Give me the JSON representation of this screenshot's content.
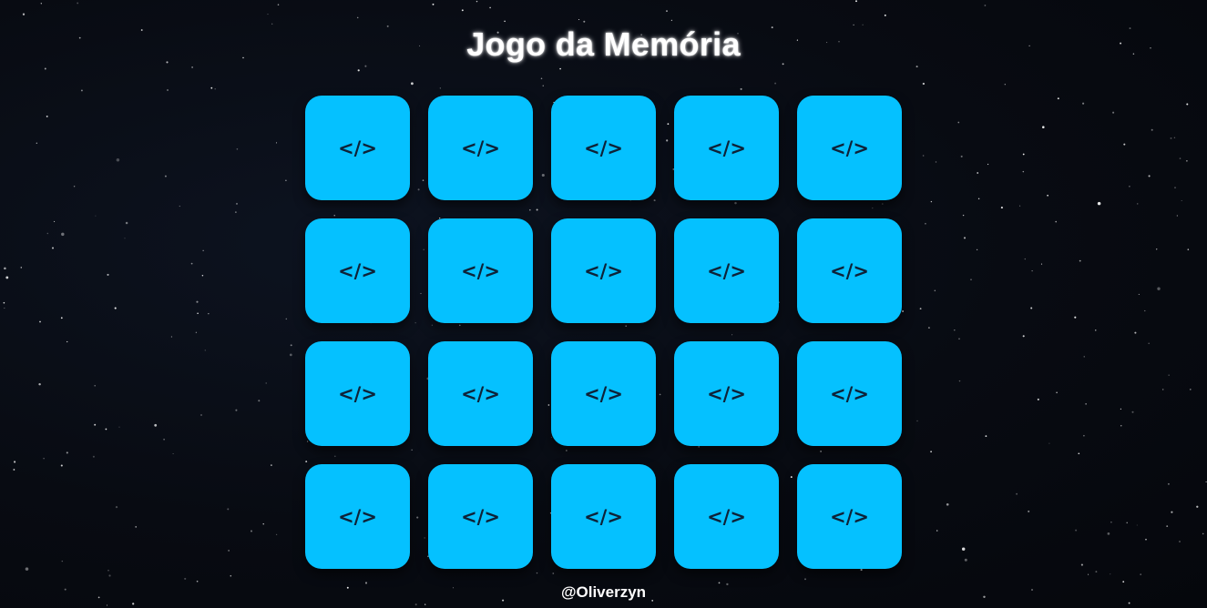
{
  "game": {
    "title": "Jogo da Memória",
    "footer": "@Oliverzyn",
    "card_back_symbol": "</>",
    "card_count": 20,
    "card_color": "#05c1ff",
    "card_symbol_color": "#0e2238"
  }
}
